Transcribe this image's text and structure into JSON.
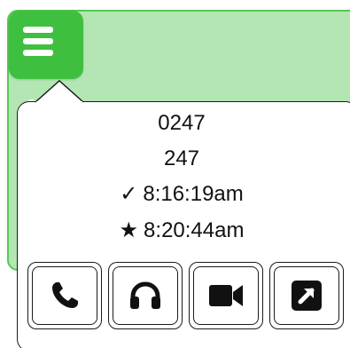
{
  "background_card": {
    "peek_text": "247",
    "fill_color": "#b3e6b3",
    "border_color": "#55c955"
  },
  "menu_button": {
    "icon": "hamburger-menu-icon",
    "color": "#3fbf3f"
  },
  "popover": {
    "line_1": "0247",
    "line_2": "247",
    "line_3_glyph": "✓",
    "line_3_time": "8:16:19am",
    "line_4_glyph": "★",
    "line_4_time": "8:20:44am"
  },
  "actions": [
    {
      "icon": "phone-icon"
    },
    {
      "icon": "headphones-icon"
    },
    {
      "icon": "video-camera-icon"
    },
    {
      "icon": "open-external-icon"
    }
  ]
}
